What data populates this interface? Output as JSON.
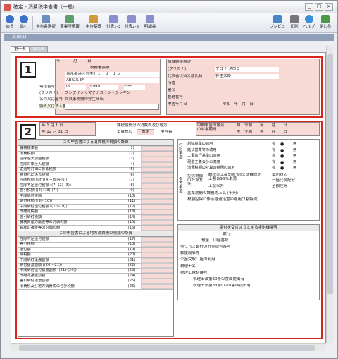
{
  "window": {
    "title": "確定 - 消費税申告書（一般）"
  },
  "toolbar": {
    "buttons": [
      {
        "label": "戻る"
      },
      {
        "label": "進む"
      },
      {
        "label": "申告書選択"
      },
      {
        "label": "事業所情報"
      },
      {
        "label": "申告基礎"
      },
      {
        "label": "付表1-3"
      },
      {
        "label": "付表2-3"
      },
      {
        "label": "明細書"
      },
      {
        "label": "プレビュー"
      },
      {
        "label": "印刷"
      },
      {
        "label": "ヘルプ"
      },
      {
        "label": "閉じる"
      }
    ]
  },
  "section_title": "上表(1)",
  "tabs": [
    "第一表",
    "第二表"
  ],
  "form": {
    "badges": [
      "1",
      "2"
    ],
    "top_left": {
      "year_label": "年",
      "month_label": "月",
      "day_label": "日",
      "office": "税務署長殿",
      "address": "東京都港区弥生町１－８－１５",
      "building": "ABビル3F",
      "phone_label": "電話番号",
      "phone": [
        "03",
        "9999",
        "****"
      ],
      "furigana_label": "(フリガナ)",
      "name_furigana": "ブンダイシャマグナカイシャグンキン",
      "name_label": "名称又は屋号",
      "name": "文具事務機の弥生商店",
      "id_label": "個人又は法人番号"
    },
    "top_right": {
      "rows": [
        {
          "label": "振替継続希望",
          "value": ""
        },
        {
          "label": "(フリガナ)",
          "value": "ヤヨイ タロウ"
        },
        {
          "label": "代表者氏名又は氏名",
          "value": "弥生太郎"
        },
        {
          "label": "所管",
          "value": ""
        },
        {
          "label": "署名",
          "value": ""
        },
        {
          "label": "整理番号",
          "value": ""
        },
        {
          "label": "申告年月日",
          "value": "令和　年　月　日"
        }
      ]
    },
    "period": {
      "from": [
        "年",
        "1",
        "月",
        "1",
        "日"
      ],
      "to": [
        "年",
        "12",
        "月",
        "31",
        "日"
      ],
      "title": "課税期間分の消費税及び地方",
      "sub1": "消費税の",
      "kind": "確定",
      "sub2": "申告書",
      "interim_label": "中間申告の場合の対象期間",
      "interim_from": "自　令和　　年　　月　　日",
      "interim_to": "至　令和　　年　　月　　日"
    },
    "calc_title": "この申告書による消費税の税額の計算",
    "calc_rows": [
      {
        "label": "課税標準額",
        "no": "(1)"
      },
      {
        "label": "消費税額",
        "no": "(2)"
      },
      {
        "label": "控除過大調整税額",
        "no": "(3)"
      },
      {
        "label": "控除対象仕入税額",
        "no": "(4)"
      },
      {
        "label": "返還等対価に係る税額",
        "no": "(5)"
      },
      {
        "label": "貸倒れに係る税額",
        "no": "(6)"
      },
      {
        "label": "控除税額小計 ((4)+(5)+(6))",
        "no": "(7)"
      },
      {
        "label": "控除不足還付税額 ((7)-(2)-(3))",
        "no": "(8)"
      },
      {
        "label": "差引税額 ((2)+(3)-(7))",
        "no": "(9)"
      },
      {
        "label": "中間納付税額",
        "no": "(10)"
      },
      {
        "label": "納付税額 ((9)-(10))",
        "no": "(11)"
      },
      {
        "label": "中間納付還付税額 ((10)-(9))",
        "no": "(12)"
      },
      {
        "label": "既確定税額",
        "no": "(13)"
      },
      {
        "label": "差引納付税額",
        "no": "(14)"
      },
      {
        "label": "課税資産の譲渡等の対価の額",
        "no": "(15)"
      },
      {
        "label": "資産の譲渡等の対価の額",
        "no": "(16)"
      }
    ],
    "local_title": "この申告書による地方消費税の税額の計算",
    "local_rows": [
      {
        "label": "控除不足還付税額",
        "no": "(17)"
      },
      {
        "label": "差引税額",
        "no": "(18)"
      },
      {
        "label": "還付額",
        "no": "(19)"
      },
      {
        "label": "納税額",
        "no": "(20)"
      },
      {
        "label": "中間納付譲渡割額",
        "no": "(21)"
      },
      {
        "label": "納付譲渡割額 ((20)-(21))",
        "no": "(22)"
      },
      {
        "label": "中間納付還付譲渡割額 ((21)-(20))",
        "no": "(23)"
      },
      {
        "label": "既確定譲渡割額",
        "no": "(24)"
      },
      {
        "label": "差引納付譲渡割額",
        "no": "(25)"
      },
      {
        "label": "消費税及び地方消費税の合計税額",
        "no": "(26)"
      }
    ],
    "side_groups": [
      "控除税額",
      "修正申告",
      "この課税期間の課税売上高",
      "譲渡割額",
      "修正申告"
    ],
    "options": {
      "group_label": "付記事項",
      "rows": [
        {
          "label": "割賦基準の適用",
          "yes": "有",
          "no": "無"
        },
        {
          "label": "延払基準等の適用",
          "yes": "有",
          "no": "無"
        },
        {
          "label": "工事進行基準の適用",
          "yes": "有",
          "no": "無"
        },
        {
          "label": "現金主義会計の適用",
          "yes": "有",
          "no": "無"
        },
        {
          "label": "消費税額の計算の特例の適用",
          "yes": "有",
          "no": "無"
        }
      ],
      "ref_label": "参考事項",
      "method_label": "控除税額の計算方法",
      "method_rows": [
        {
          "label": "課税売上高5億円超又は課税売上割合95%未満",
          "a": "個別対応",
          "b": "一括比例配分"
        },
        {
          "label": "上記以外",
          "a": "全額控除",
          "b": ""
        }
      ],
      "base_row": "基準期間の課税売上高 (千円)",
      "special_row": "税額控除に係る経過措置の適用(2割特例)"
    },
    "bank": {
      "title": "還付を受けようとする金融機関等",
      "rows": [
        "銀行",
        "預金　口座番号",
        "ゆうちょ銀行の貯金記号番号",
        "郵便局名等",
        "公金受取口座の利用"
      ],
      "tax_label": "税理士名",
      "tax_phone": "税理士電話番号",
      "law1": "税理士法第30条の書面提出有",
      "law2": "税理士法第33条の2の書面提出有"
    }
  }
}
